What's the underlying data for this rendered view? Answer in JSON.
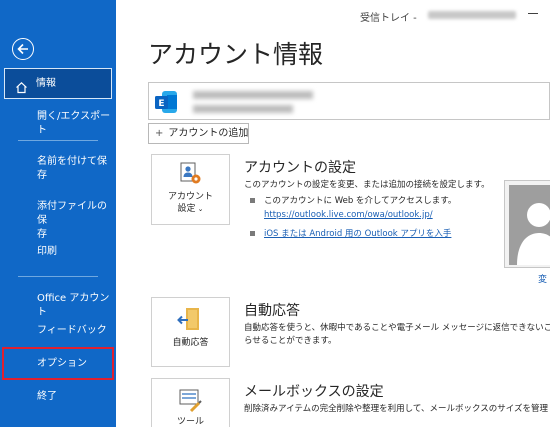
{
  "titlebar": {
    "folder_label": "受信トレイ - "
  },
  "sidebar": {
    "items": [
      {
        "label": "情報"
      },
      {
        "label": "開く/エクスポート"
      },
      {
        "label": "名前を付けて保",
        "label2": "存"
      },
      {
        "label": "添付ファイルの保",
        "label2": "存"
      },
      {
        "label": "印刷"
      },
      {
        "label": "Office アカウント"
      },
      {
        "label": "フィードバック"
      },
      {
        "label": "オプション"
      },
      {
        "label": "終了"
      }
    ]
  },
  "main": {
    "title": "アカウント情報",
    "add_account_label": "アカウントの追加",
    "sections": [
      {
        "tile_line1": "アカウント",
        "tile_line2": "設定",
        "title": "アカウントの設定",
        "description": "このアカウントの設定を変更、または追加の接続を設定します。",
        "bullets": [
          {
            "text": "このアカウントに Web を介してアクセスします。"
          },
          {
            "text": "https://outlook.live.com/owa/outlook.jp/"
          },
          {
            "text": "iOS または Android 用の Outlook アプリを入手"
          }
        ]
      },
      {
        "tile_line1": "自動応答",
        "title": "自動応答",
        "description_line1": "自動応答を使うと、休暇中であることや電子メール メッセージに返信できないこと",
        "description_line2": "らせることができます。"
      },
      {
        "tile_line1": "ツール",
        "title": "メールボックスの設定",
        "description": "削除済みアイテムの完全削除や整理を利用して、メールボックスのサイズを管理し"
      }
    ],
    "profile_change_link": "変"
  },
  "colors": {
    "sidebar_bg": "#1068c7",
    "highlight": "#e0202f",
    "link": "#1a5fb4"
  }
}
